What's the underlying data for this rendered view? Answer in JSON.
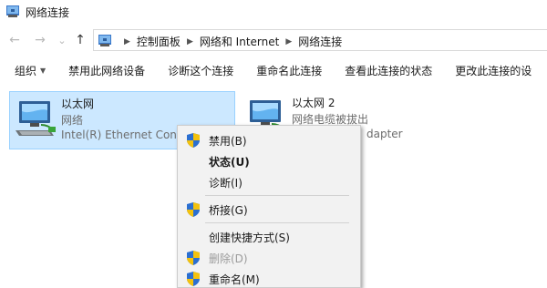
{
  "window": {
    "title": "网络连接"
  },
  "nav": {
    "back_glyph": "←",
    "forward_glyph": "→",
    "recent_glyph": "⌄",
    "up_glyph": "↑",
    "breadcrumbs": [
      "控制面板",
      "网络和 Internet",
      "网络连接"
    ]
  },
  "toolbar": {
    "items": [
      "组织",
      "禁用此网络设备",
      "诊断这个连接",
      "重命名此连接",
      "查看此连接的状态",
      "更改此连接的设"
    ]
  },
  "adapters": [
    {
      "name": "以太网",
      "status": "网络",
      "device": "Intel(R) Ethernet Conn",
      "selected": true
    },
    {
      "name": "以太网 2",
      "status": "网络电缆被拔出",
      "device": "dapter",
      "selected": false
    }
  ],
  "context_menu": {
    "items": [
      {
        "label": "禁用(B)",
        "icon": "shield-icon",
        "bold": false,
        "disabled": false
      },
      {
        "label": "状态(U)",
        "icon": "",
        "bold": true,
        "disabled": false
      },
      {
        "label": "诊断(I)",
        "icon": "",
        "bold": false,
        "disabled": false
      },
      {
        "label": "桥接(G)",
        "icon": "shield-icon",
        "bold": false,
        "disabled": false
      },
      {
        "label": "创建快捷方式(S)",
        "icon": "",
        "bold": false,
        "disabled": false
      },
      {
        "label": "删除(D)",
        "icon": "shield-icon",
        "bold": false,
        "disabled": true
      },
      {
        "label": "重命名(M)",
        "icon": "shield-icon",
        "bold": false,
        "disabled": false
      }
    ]
  },
  "colors": {
    "selection_bg": "#cce8ff",
    "selection_border": "#99d1ff",
    "menu_bg": "#f2f2f2"
  }
}
